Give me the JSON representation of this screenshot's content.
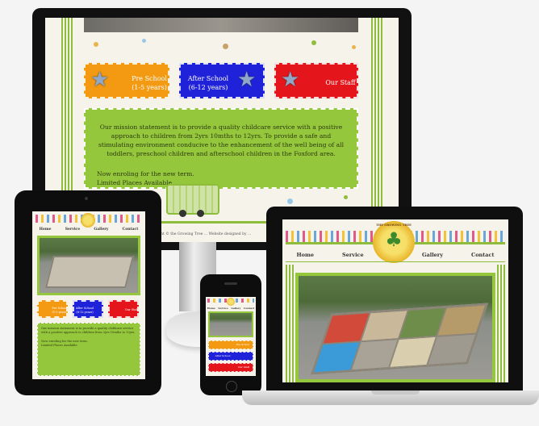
{
  "colors": {
    "accent_green": "#95c73c",
    "tile_orange": "#f39a12",
    "tile_blue": "#1f22d8",
    "tile_red": "#e5161b",
    "device_black": "#0f0f0f"
  },
  "monitor": {
    "tiles": [
      {
        "title": "Pre School",
        "subtitle": "(1-5 years)",
        "icon": "star-badge-icon"
      },
      {
        "title": "After School",
        "subtitle": "(6-12 years)",
        "icon": "star-badge-icon"
      },
      {
        "title": "Our Staff",
        "subtitle": "",
        "icon": "star-badge-icon"
      }
    ],
    "mission_text": "Our mission statement is to provide a quality childcare service with a positive approach to children from 2yrs 10mths to 12yrs. To provide a safe and stimulating environment conducive to the enhancement of the well being of all toddlers, preschool children and afterschool children in the Foxford area.",
    "enrol_line1": "Now enroling for the new term.",
    "enrol_line2": "Limited Places Available",
    "copyright": "copyright © the Growing Tree ... Website designed by ..."
  },
  "laptop": {
    "logo_text": "THE GROWING TREE",
    "nav": [
      "Home",
      "Service",
      "Gallery",
      "Contact"
    ]
  },
  "tablet": {
    "nav": [
      "Home",
      "Service",
      "Gallery",
      "Contact"
    ],
    "tiles": [
      "Pre School (1-5 years)",
      "After School (6-12 years)",
      "Our Staff"
    ],
    "mission_text": "Our mission statement is to provide a quality childcare service with a positive approach to children from 2yrs 10mths to 12yrs.",
    "enrol_line1": "Now enroling for the new term.",
    "enrol_line2": "Limited Places Available"
  },
  "phone": {
    "nav": [
      "Home",
      "Service",
      "Gallery",
      "Contact"
    ],
    "tiles": [
      "Pre School",
      "After School",
      "Our Staff"
    ]
  }
}
